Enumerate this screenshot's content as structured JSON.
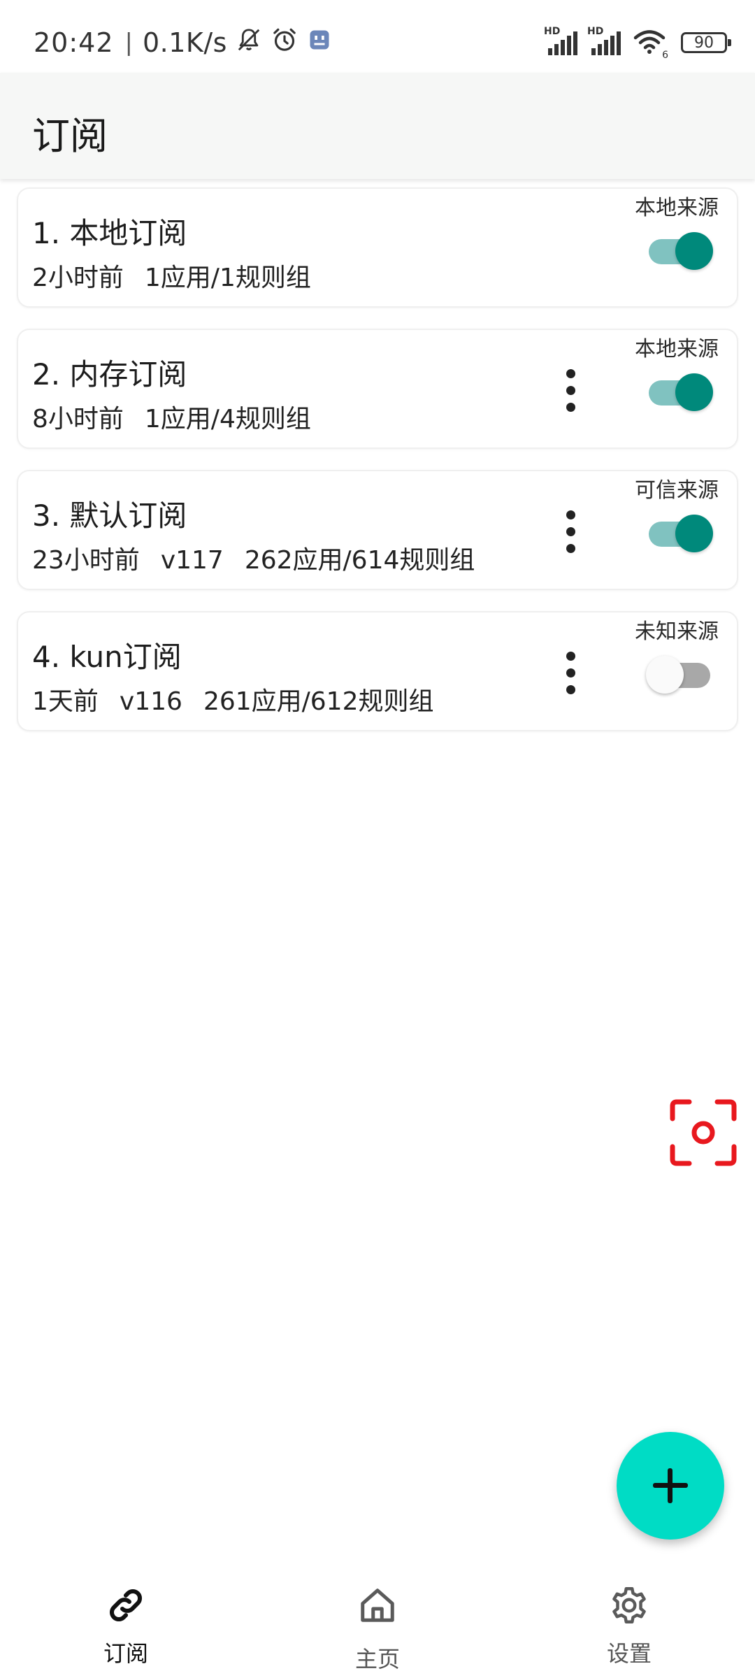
{
  "status_bar": {
    "time": "20:42",
    "separator": "|",
    "net_speed": "0.1K/s",
    "signal1_label": "HD",
    "signal2_label": "HD",
    "wifi_sub": "6",
    "battery": "90",
    "icons": [
      "bell-off-icon",
      "alarm-icon",
      "app-notification-icon",
      "signal-icon",
      "signal-icon",
      "wifi-icon",
      "battery-icon"
    ]
  },
  "app_bar": {
    "title": "订阅"
  },
  "subscriptions": [
    {
      "title": "1. 本地订阅",
      "updated": "2小时前",
      "version": "",
      "counts": "1应用/1规则组",
      "source": "本地来源",
      "enabled": true,
      "has_menu": false
    },
    {
      "title": "2. 内存订阅",
      "updated": "8小时前",
      "version": "",
      "counts": "1应用/4规则组",
      "source": "本地来源",
      "enabled": true,
      "has_menu": true
    },
    {
      "title": "3. 默认订阅",
      "updated": "23小时前",
      "version": "v117",
      "counts": "262应用/614规则组",
      "source": "可信来源",
      "enabled": true,
      "has_menu": true
    },
    {
      "title": "4. kun订阅",
      "updated": "1天前",
      "version": "v116",
      "counts": "261应用/612规则组",
      "source": "未知来源",
      "enabled": false,
      "has_menu": true
    }
  ],
  "fab": {
    "icon": "plus-icon"
  },
  "scan_button": {
    "icon": "screenshot-snapshot-icon",
    "color": "#e8181e"
  },
  "bottom_nav": {
    "items": [
      {
        "label": "订阅",
        "icon": "link-icon",
        "active": true
      },
      {
        "label": "主页",
        "icon": "home-icon",
        "active": false
      },
      {
        "label": "设置",
        "icon": "gear-icon",
        "active": false
      }
    ]
  },
  "colors": {
    "switch_on_thumb": "#00897b",
    "switch_on_track": "#80c2c0",
    "switch_off_track": "#a8a8a8",
    "fab": "#00dcc5",
    "app_bar": "#f6f7f6"
  }
}
